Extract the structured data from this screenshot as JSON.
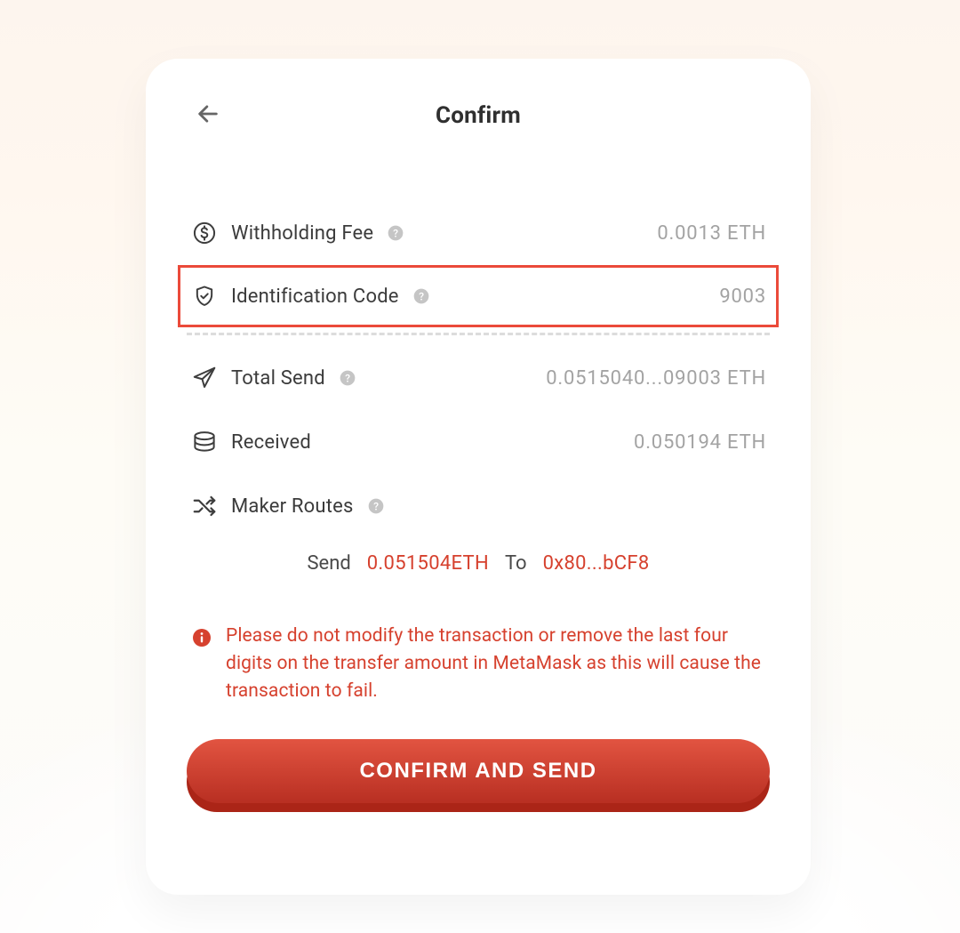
{
  "header": {
    "title": "Confirm"
  },
  "rows": {
    "fee": {
      "label": "Withholding Fee",
      "value": "0.0013 ETH"
    },
    "code": {
      "label": "Identification Code",
      "value": "9003"
    },
    "totalSend": {
      "label": "Total Send",
      "value": "0.0515040...09003 ETH"
    },
    "received": {
      "label": "Received",
      "value": "0.050194 ETH"
    },
    "routes": {
      "label": "Maker Routes"
    }
  },
  "route": {
    "sendLabel": "Send",
    "sendValue": "0.051504ETH",
    "toLabel": "To",
    "toValue": "0x80...bCF8"
  },
  "warning": {
    "text": "Please do not modify the transaction or remove the last four digits on the transfer amount in MetaMask as this will cause the transaction to fail."
  },
  "cta": {
    "label": "CONFIRM AND SEND"
  }
}
